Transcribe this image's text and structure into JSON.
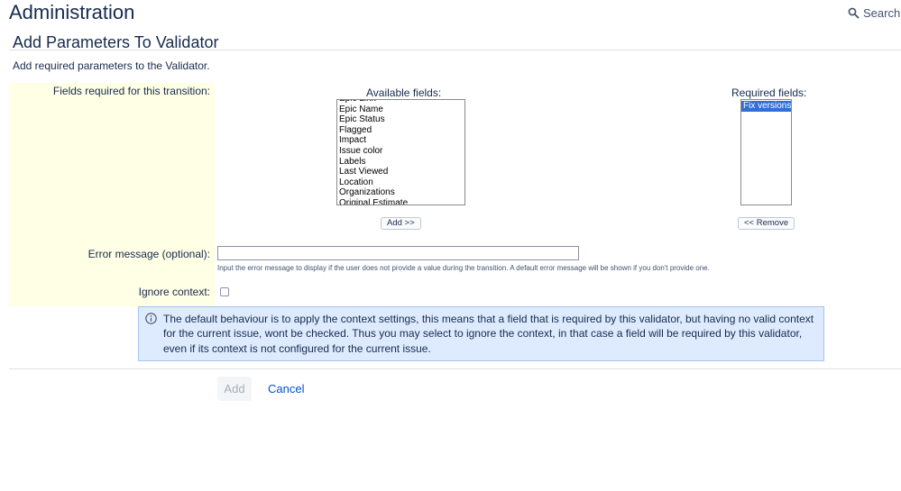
{
  "header": {
    "title": "Administration",
    "search_label": "Search J",
    "search_icon": "search-icon"
  },
  "form": {
    "title": "Add Parameters To Validator",
    "description": "Add required parameters to the Validator.",
    "fields_label": "Fields required for this transition:",
    "available_heading": "Available fields:",
    "required_heading": "Required fields:",
    "available_options": [
      "Epic Link",
      "Epic Name",
      "Epic Status",
      "Flagged",
      "Impact",
      "Issue color",
      "Labels",
      "Last Viewed",
      "Location",
      "Organizations",
      "Original Estimate"
    ],
    "required_options": [
      "Fix versions"
    ],
    "add_button": "Add >>",
    "remove_button": "<< Remove",
    "error_label": "Error message (optional):",
    "error_value": "",
    "error_hint": "Input the error message to display if the user does not provide a value during the transition. A default error message will be shown if you don't provide one.",
    "ignore_label": "Ignore context:",
    "ignore_checked": false,
    "info_icon": "info-icon",
    "info_text": "The default behaviour is to apply the context settings, this means that a field that is required by this validator, but having no valid context for the current issue, wont be checked. Thus you may select to ignore the context, in that case a field will be required by this validator, even if its context is not configured for the current issue.",
    "submit_label": "Add",
    "cancel_label": "Cancel"
  },
  "colors": {
    "label_panel": "#ffffe5",
    "info_bg": "#deebff",
    "link": "#0052cc",
    "selection": "#2f6fd6"
  }
}
